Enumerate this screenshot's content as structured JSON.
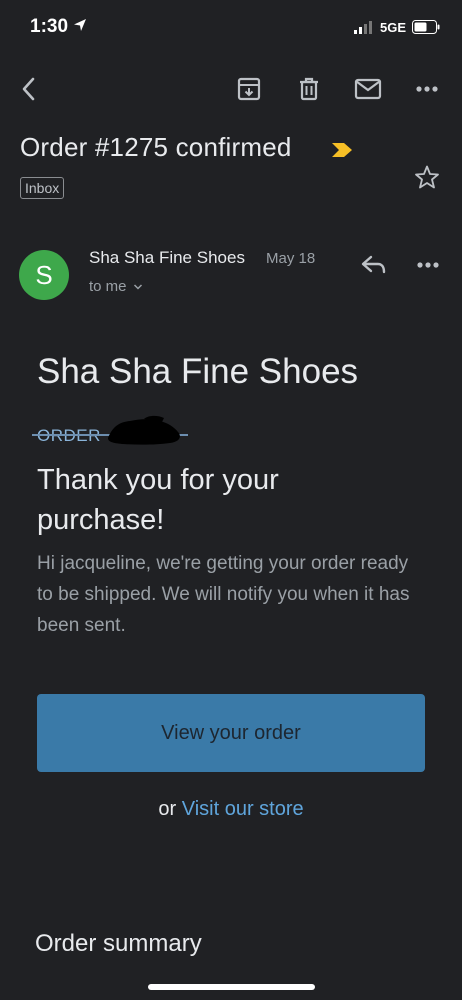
{
  "status_bar": {
    "time": "1:30",
    "network": "5GE"
  },
  "toolbar": {
    "back_icon": "back-arrow-icon",
    "archive_icon": "archive-icon",
    "delete_icon": "trash-icon",
    "mark_unread_icon": "mail-icon",
    "more_icon": "more-icon"
  },
  "email": {
    "subject": "Order #1275 confirmed",
    "label": "Inbox",
    "sender_initial": "S",
    "sender_name": "Sha Sha Fine Shoes",
    "date": "May 18",
    "recipient": "to me",
    "avatar_color": "#3ea84b",
    "importance_color": "#f6bf26"
  },
  "body": {
    "shop_name": "Sha Sha Fine Shoes",
    "order_label": "ORDER",
    "thanks_heading": "Thank you for your purchase!",
    "message": "Hi jacqueline, we're getting your order ready to be shipped. We will notify you when it has been sent.",
    "button_label": "View your order",
    "or_text": "or",
    "store_link": "Visit our store",
    "summary_heading": "Order summary",
    "button_color": "#3a7aa8",
    "link_color": "#5fa5dc"
  }
}
